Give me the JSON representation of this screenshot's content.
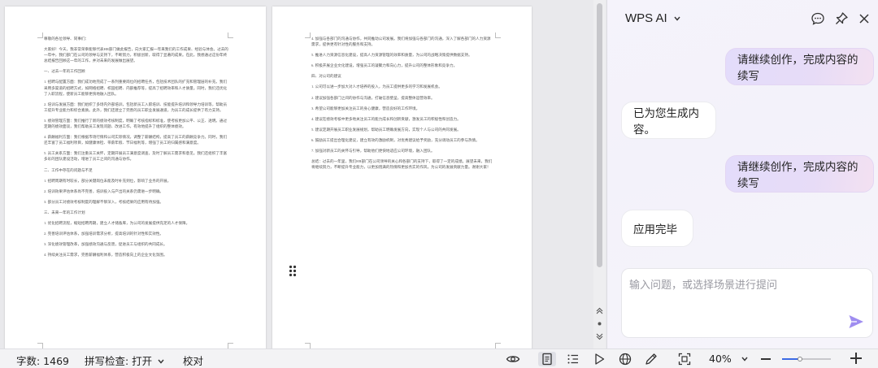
{
  "document": {
    "page1": [
      "尊敬的各位领导、同事们：",
      "大家好！今天，我非常荣幸能够代表HR部门做此报告，向大家汇报一年来我们的工作成果、经验与体会。过去的一年中，我们部门在公司的领导与支持下，不断努力，积极创新，取得了显著的成果。在此，我想通过这份年终总结报告回顾这一年的工作，并对未来的发展做出展望。",
      "一、过去一年的工作回顾",
      "1. 招聘与配置方面：我们成功地完成了一系列重要岗位的招聘任务，包括技术团队的扩充和管理层的补充。我们采用多渠道的招聘方式，如网络招聘、校园招聘、内部推荐等，提高了招聘效率和人才质量。同时，我们还优化了入职流程，使新员工能够更快地融入团队。",
      "2. 培训与发展方面：我们组织了多场内外部培训，包括新员工入职培训、技能提升培训和领导力培训等，帮助员工提升专业能力和综合素质。此外，我们还建立了完善的员工职业发展通道，为员工的成长提供了有力支持。",
      "3. 绩效管理方面：我们推行了新的绩效考核制度，明确了考核指标和标准，使考核更加公平、公正、透明。通过定期的绩效面谈，我们帮助员工发现问题、改进工作，有效地提升了组织的整体绩效。",
      "4. 薪酬福利方面：我们根据市场行情和公司实际情况，调整了薪酬结构，提高了员工的薪酬竞争力。同时，我们还丰富了员工福利项目，如健康体检、带薪年假、节日福利等，增强了员工的归属感和满意度。",
      "5. 员工关系方面：我们注重员工关怀，定期开展员工满意度调查，及时了解员工需求和意见。我们还组织了丰富多彩的团队建设活动，增进了员工之间的沟通与协作。",
      "二、工作中存在的问题与不足",
      "1. 招聘周期有时较长，部分关键岗位未能及时补充到位，影响了业务的开展。",
      "2. 培训效果评估体系尚不完善，培训投入与产出的关系仍需进一步明确。",
      "3. 部分员工对绩效考核制度的理解不够深入，考核结果的应用有待加强。",
      "三、未来一年的工作计划",
      "1. 优化招聘流程，缩短招聘周期，建立人才储备库，为公司的发展提供充足的人才保障。",
      "2. 完善培训评估体系，加强培训需求分析，提高培训的针对性和实效性。",
      "3. 深化绩效管理改革，加强绩效沟通与反馈，促进员工与组织的共同成长。",
      "4. 持续关注员工需求，完善薪酬福利体系，营造积极向上的企业文化氛围。"
    ],
    "page2": [
      "4. 加强与各部门的沟通与协作，共同推动公司发展。我们将加强与各部门的沟通，深入了解各部门的人力资源需求，提供更有针对性的服务和支持。",
      "5. 推进人力资源信息化建设，提高人力资源管理的效率和质量，为公司的战略决策提供数据支持。",
      "6. 积极开展企业文化建设，增强员工的凝聚力和向心力，提升公司的整体形象和竞争力。",
      "四、对公司的建议",
      "1. 公司可以进一步加大对人才培养的投入，为员工提供更多的学习和发展机会。",
      "2. 建议加强各部门之间的协作与沟通，打破信息壁垒，提高整体运营效率。",
      "3. 希望公司能够更加关注员工的身心健康，营造良好的工作环境。",
      "4. 建议在绩效考核中更多地关注员工的能力成长和创新贡献，激发员工的积极性和创造力。",
      "5. 建议定期开展员工职业发展规划，帮助员工明确发展方向，实现个人与公司的共同发展。",
      "6. 鼓励员工提出合理化建议，建立有效的激励机制，对优秀建议给予奖励，充分调动员工的参与热情。",
      "7. 加强对新员工的关怀与引导，帮助他们更快地适应公司环境，融入团队。",
      "总结：过去的一年里，我们HR部门在公司领导的关心和各部门的支持下，取得了一定的成绩。展望未来，我们将继续努力，不断提升专业能力，以更加饱满的热情和更加务实的作风，为公司的发展贡献力量。谢谢大家！"
    ]
  },
  "ai_panel": {
    "title": "WPS AI",
    "header_icons": [
      "chat-bubble-icon",
      "pin-icon",
      "close-icon"
    ],
    "messages": [
      {
        "role": "user",
        "text": "请继续创作，完成内容的续写"
      },
      {
        "role": "ai",
        "text": "已为您生成内容。"
      },
      {
        "role": "user",
        "text": "请继续创作，完成内容的续写"
      },
      {
        "role": "ai",
        "text": "应用完毕"
      }
    ],
    "input_placeholder": "输入问题，或选择场景进行提问",
    "input_value": ""
  },
  "statusbar": {
    "word_count": "字数: 1469",
    "spell_check": "拼写检查: 打开",
    "proofread": "校对",
    "zoom": "40%",
    "zoom_fraction": 0.36,
    "icons": [
      "eye-icon",
      "page-view-icon",
      "outline-view-icon",
      "play-icon",
      "globe-icon",
      "pen-icon",
      "fit-screen-icon"
    ]
  },
  "colors": {
    "accent": "#3c6be5",
    "user_bubble": "#e5dcfa",
    "send_icon": "#9f8df0"
  }
}
